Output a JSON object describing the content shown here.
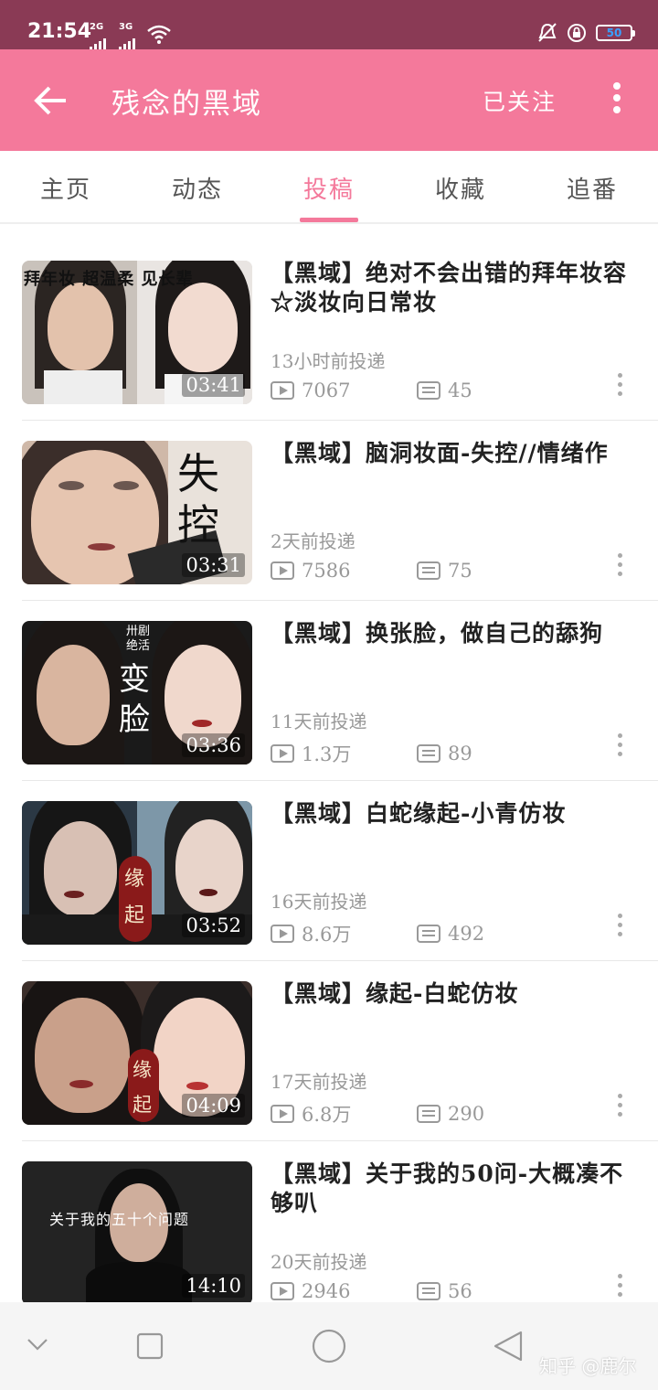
{
  "status_bar": {
    "time": "21:54",
    "signal1": "2G",
    "signal2": "3G",
    "battery": "50"
  },
  "app_bar": {
    "title": "残念的黑域",
    "follow_label": "已关注",
    "bg_color": "#f4799b"
  },
  "tabs": [
    {
      "label": "主页",
      "active": false
    },
    {
      "label": "动态",
      "active": false
    },
    {
      "label": "投稿",
      "active": true
    },
    {
      "label": "收藏",
      "active": false
    },
    {
      "label": "追番",
      "active": false
    }
  ],
  "videos": [
    {
      "title": "【黑域】绝对不会出错的拜年妆容☆淡妆向日常妆",
      "posted": "13小时前投递",
      "views": "7067",
      "danmaku": "45",
      "duration": "03:41",
      "thumb_text": "拜年妆 超温柔 见长辈"
    },
    {
      "title": "【黑域】脑洞妆面-失控//情绪作",
      "posted": "2天前投递",
      "views": "7586",
      "danmaku": "75",
      "duration": "03:31",
      "thumb_text": "失控"
    },
    {
      "title": "【黑域】换张脸，做自己的舔狗",
      "posted": "11天前投递",
      "views": "1.3万",
      "danmaku": "89",
      "duration": "03:36",
      "thumb_text": "变脸",
      "thumb_small": "卅剧 绝活"
    },
    {
      "title": "【黑域】白蛇缘起-小青仿妆",
      "posted": "16天前投递",
      "views": "8.6万",
      "danmaku": "492",
      "duration": "03:52",
      "thumb_text": "缘起"
    },
    {
      "title": "【黑域】缘起-白蛇仿妆",
      "posted": "17天前投递",
      "views": "6.8万",
      "danmaku": "290",
      "duration": "04:09",
      "thumb_text": "缘起"
    },
    {
      "title": "【黑域】关于我的50问-大概凑不够叭",
      "posted": "20天前投递",
      "views": "2946",
      "danmaku": "56",
      "duration": "14:10",
      "thumb_text": "关于我的五十个问题"
    }
  ],
  "watermark": "知乎 @鹿尔"
}
